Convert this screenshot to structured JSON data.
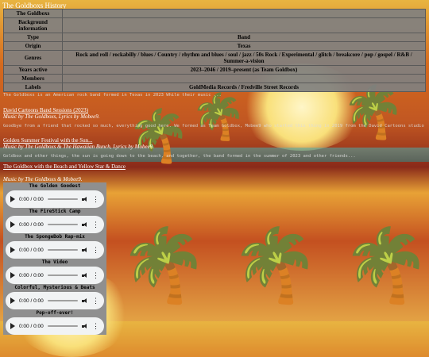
{
  "site_title": "The Goldboxs History",
  "infobox": {
    "name": "The Goldboxs",
    "rows": [
      {
        "label": "Background information",
        "value": ""
      },
      {
        "label": "Type",
        "value": "Band"
      },
      {
        "label": "Origin",
        "value": "Texas"
      },
      {
        "label": "Genres",
        "value": "Rock and roll / rockabilly / blues / Country / rhythm and blues / soul / jazz / 50s Rock / Experimental / glitch / breakcore / pop / gospel / R&B / Summer-a-vision"
      },
      {
        "label": "Years active",
        "value": "2023–2046 / 2019–present (as Team Goldbox)"
      },
      {
        "label": "Members",
        "value": ""
      },
      {
        "label": "Labels",
        "value": "GoldMedia Records / Fredville Street Records"
      }
    ]
  },
  "intro_paragraph": "The Goldboxs is an American rock band formed in Texas in 2023 While their music ...",
  "links": [
    {
      "title": "David Cartoons Band Sessions (2023)",
      "caption": "Music by The Goldboxs, Lyrics by Mobee9."
    },
    {
      "title": "Golden Summer Festival with the Sun...",
      "caption": "Music by The Goldboxs & The Hawaiian Bunch, Lyrics by Mobee9."
    },
    {
      "title": "The Goldbox with the Beach and Yellow Star & Dance",
      "caption": ""
    }
  ],
  "paragraphs": [
    "Goodbye from a friend that rocked so much, everything good here. We formed as Team Goldbox, Mobee9 who started this thing in 2019 from the David Cartoons studio",
    "Goldbox and other things, the sun is going down to the beach, and together, the band formed in the summer of 2023 and other friends..."
  ],
  "music_credit": "Music by The Goldboxs & Mobee9.",
  "playlist": [
    {
      "title": "The Golden Goodest",
      "time": "0:00 / 0:00"
    },
    {
      "title": "The FireStick Camp",
      "time": "0:00 / 0:00"
    },
    {
      "title": "The SpongeBob Rap-mix",
      "time": "0:00 / 0:00"
    },
    {
      "title": "The Video",
      "time": "0:00 / 0:00"
    },
    {
      "title": "Colorful, Mysterious & Beats",
      "time": "0:00 / 0:00"
    },
    {
      "title": "Pop-off-ever!",
      "time": "0:00 / 0:00"
    }
  ],
  "icons": {
    "play": "play-icon",
    "volume": "volume-icon",
    "more": "more-options-icon"
  },
  "colors": {
    "infobox_bg": "#808080",
    "player_bg": "#f1f3f4",
    "text": "#ffffff"
  }
}
